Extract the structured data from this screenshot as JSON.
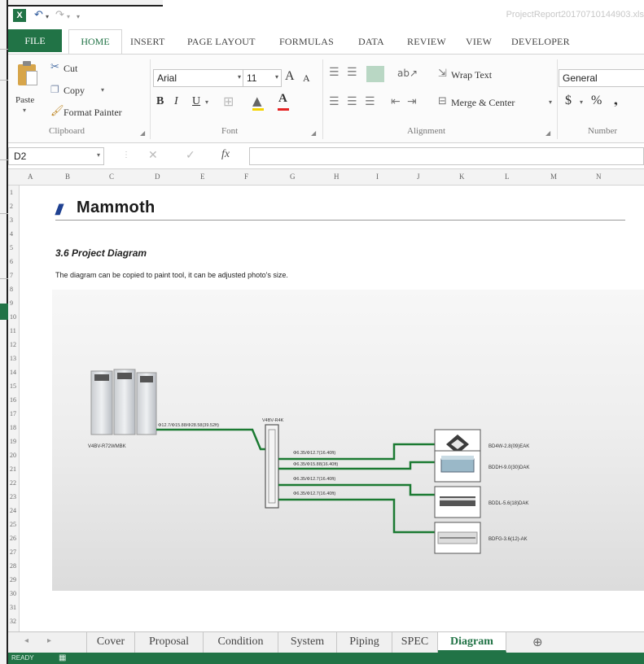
{
  "app": {
    "doc_title": "ProjectReport20170710144903.xls",
    "qat": {
      "undo_icon": "undo-icon",
      "redo_icon": "redo-icon"
    }
  },
  "tabs": [
    "FILE",
    "HOME",
    "INSERT",
    "PAGE LAYOUT",
    "FORMULAS",
    "DATA",
    "REVIEW",
    "VIEW",
    "DEVELOPER"
  ],
  "ribbon": {
    "clipboard": {
      "paste": "Paste",
      "cut": "Cut",
      "copy": "Copy",
      "format_painter": "Format Painter",
      "group": "Clipboard"
    },
    "font": {
      "name": "Arial",
      "size": "11",
      "bold": "B",
      "italic": "I",
      "underline": "U",
      "grow": "A",
      "shrink": "A",
      "group": "Font"
    },
    "alignment": {
      "wrap": "Wrap Text",
      "merge": "Merge & Center",
      "group": "Alignment"
    },
    "number": {
      "format": "General",
      "currency": "$",
      "percent": "%",
      "group": "Number"
    }
  },
  "formula_bar": {
    "name_box": "D2",
    "fx": "fx",
    "value": ""
  },
  "columns": [
    "A",
    "B",
    "C",
    "D",
    "E",
    "F",
    "G",
    "H",
    "I",
    "J",
    "K",
    "L",
    "M",
    "N"
  ],
  "rows": [
    "1",
    "2",
    "3",
    "4",
    "5",
    "6",
    "7",
    "8",
    "9",
    "10",
    "11",
    "12",
    "13",
    "14",
    "15",
    "16",
    "17",
    "18",
    "19",
    "20",
    "21",
    "22",
    "23",
    "24",
    "25",
    "26",
    "27",
    "28",
    "29",
    "30",
    "31",
    "32"
  ],
  "sheet": {
    "logo_bars": "///",
    "logo_name": "Mammoth",
    "section_title": "3.6  Project Diagram",
    "section_desc": "The diagram can be copied to paint tool, it can be adjusted photo's size."
  },
  "diagram": {
    "outdoor_unit": "V4BV-R72WMBK",
    "main_pipe": "Φ12.7/Φ15.88/Φ28.58(39.52ft)",
    "branch_box": "V4BV-R4K",
    "branches": [
      {
        "pipe": "Φ6.35/Φ12.7(16.40ft)",
        "unit": "BD4W-2.8(09)EAK"
      },
      {
        "pipe": "Φ6.35/Φ15.88(16.40ft)",
        "unit": "BDDH-9.0(30)DAK"
      },
      {
        "pipe": "Φ6.35/Φ12.7(16.40ft)",
        "unit": "BDDL-5.6(18)DAK"
      },
      {
        "pipe": "Φ6.35/Φ12.7(16.40ft)",
        "unit": "BDFG-3.6(12)-AK"
      }
    ]
  },
  "sheet_tabs": [
    "Cover",
    "Proposal",
    "Condition",
    "System",
    "Piping",
    "SPEC",
    "Diagram"
  ],
  "active_tab": "Diagram",
  "status": "READY",
  "colors": {
    "excel_green": "#217346",
    "pipe_green": "#1b7a32",
    "logo_blue": "#1a3d8f"
  }
}
